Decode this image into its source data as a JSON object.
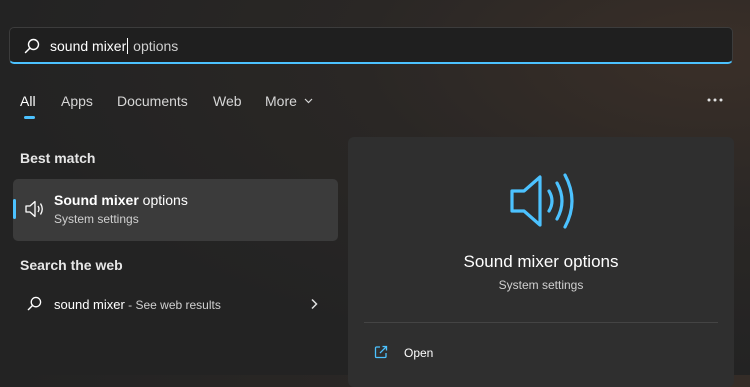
{
  "search": {
    "typed": "sound mixer",
    "suggestion": " options"
  },
  "tabs": [
    {
      "label": "All",
      "active": true
    },
    {
      "label": "Apps"
    },
    {
      "label": "Documents"
    },
    {
      "label": "Web"
    },
    {
      "label": "More"
    }
  ],
  "more_options_icon": "ellipsis-icon",
  "best_match": {
    "heading": "Best match",
    "title_bold": "Sound mixer",
    "title_rest": " options",
    "subtitle": "System settings",
    "icon": "speaker-icon"
  },
  "web": {
    "heading": "Search the web",
    "query": "sound mixer",
    "suffix": " - See web results"
  },
  "preview": {
    "title": "Sound mixer options",
    "subtitle": "System settings",
    "actions": [
      {
        "label": "Open",
        "icon": "external-link-icon"
      }
    ]
  },
  "colors": {
    "accent": "#4cc2ff"
  }
}
